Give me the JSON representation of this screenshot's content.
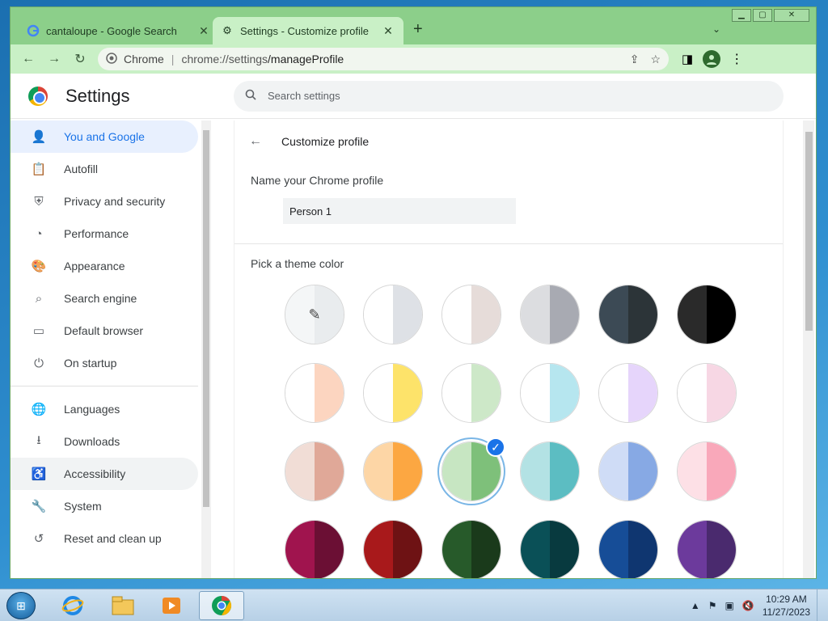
{
  "browser": {
    "tabs": [
      {
        "title": "cantaloupe - Google Search",
        "active": false
      },
      {
        "title": "Settings - Customize profile",
        "active": true
      }
    ],
    "new_tab": "+",
    "omnibox": {
      "scheme_label": "Chrome",
      "host": "chrome://settings",
      "path": "/manageProfile"
    }
  },
  "settings": {
    "title": "Settings",
    "search_placeholder": "Search settings",
    "nav": [
      {
        "label": "You and Google",
        "icon": "person-icon",
        "active": true
      },
      {
        "label": "Autofill",
        "icon": "clipboard-icon"
      },
      {
        "label": "Privacy and security",
        "icon": "shield-icon"
      },
      {
        "label": "Performance",
        "icon": "speedometer-icon"
      },
      {
        "label": "Appearance",
        "icon": "palette-icon"
      },
      {
        "label": "Search engine",
        "icon": "search-icon"
      },
      {
        "label": "Default browser",
        "icon": "browser-window-icon"
      },
      {
        "label": "On startup",
        "icon": "power-icon"
      },
      {
        "label": "Languages",
        "icon": "globe-icon"
      },
      {
        "label": "Downloads",
        "icon": "download-icon"
      },
      {
        "label": "Accessibility",
        "icon": "accessibility-icon",
        "hover": true
      },
      {
        "label": "System",
        "icon": "wrench-icon"
      },
      {
        "label": "Reset and clean up",
        "icon": "reset-icon"
      }
    ],
    "page": {
      "heading": "Customize profile",
      "name_section": "Name your Chrome profile",
      "profile_name": "Person 1",
      "theme_section": "Pick a theme color",
      "swatches": [
        {
          "left": "#f4f6f7",
          "right": "#e9ecee",
          "kind": "picker"
        },
        {
          "left": "#ffffff",
          "right": "#dee1e6"
        },
        {
          "left": "#ffffff",
          "right": "#e6dcd9"
        },
        {
          "left": "#dcdde0",
          "right": "#a8aab2"
        },
        {
          "left": "#3c4a55",
          "right": "#2c3438"
        },
        {
          "left": "#2a2a2a",
          "right": "#000000"
        },
        {
          "left": "#ffffff",
          "right": "#fcd5c0"
        },
        {
          "left": "#ffffff",
          "right": "#fde36a"
        },
        {
          "left": "#ffffff",
          "right": "#cde8c8"
        },
        {
          "left": "#ffffff",
          "right": "#b6e6ef"
        },
        {
          "left": "#ffffff",
          "right": "#e6d5fb"
        },
        {
          "left": "#ffffff",
          "right": "#f7d7e4"
        },
        {
          "left": "#f1ddd6",
          "right": "#e0a898"
        },
        {
          "left": "#fdd6a6",
          "right": "#fca742"
        },
        {
          "left": "#c7e6c2",
          "right": "#7ec07a",
          "selected": true
        },
        {
          "left": "#b3e2e4",
          "right": "#5cbdc2"
        },
        {
          "left": "#cfdcf6",
          "right": "#87a9e4"
        },
        {
          "left": "#fde0e6",
          "right": "#f9a8ba"
        },
        {
          "left": "#a0144e",
          "right": "#6b0f34"
        },
        {
          "left": "#a8191b",
          "right": "#6e1214"
        },
        {
          "left": "#275a2a",
          "right": "#1a3a1b"
        },
        {
          "left": "#0a5057",
          "right": "#083a3f"
        },
        {
          "left": "#164d97",
          "right": "#0f3670"
        },
        {
          "left": "#6c3a9c",
          "right": "#4a2a6e"
        }
      ]
    }
  },
  "taskbar": {
    "time": "10:29 AM",
    "date": "11/27/2023",
    "apps": [
      "internet-explorer-icon",
      "file-explorer-icon",
      "media-player-icon",
      "chrome-icon"
    ]
  }
}
